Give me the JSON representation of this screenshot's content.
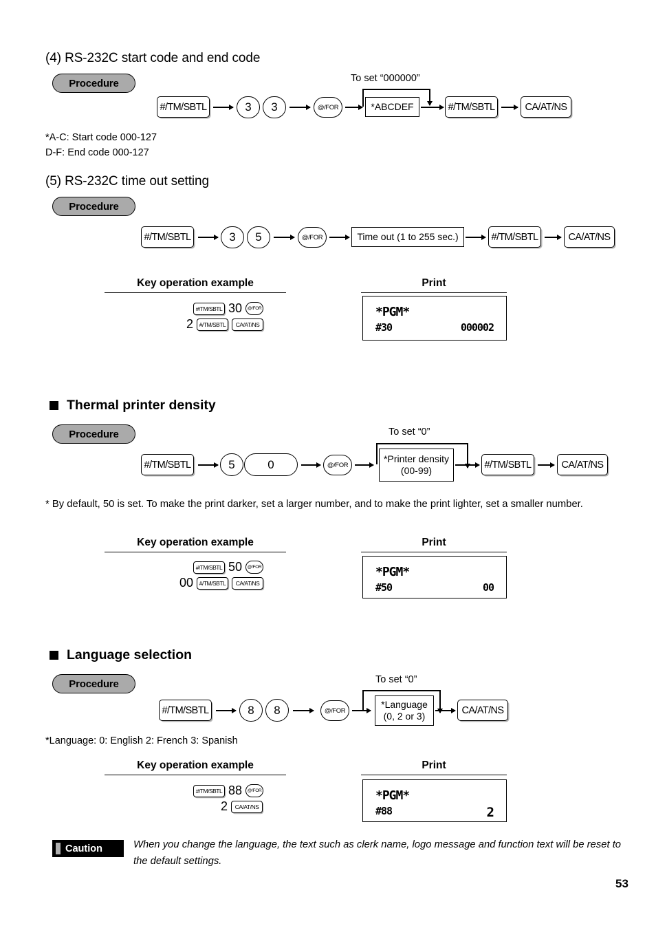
{
  "page": {
    "number": "53"
  },
  "section4": {
    "title": "(4) RS-232C start code and end code",
    "procedure_label": "Procedure",
    "bypass_label": "To set “000000”",
    "flow": [
      {
        "type": "key",
        "label": "#/TM/SBTL"
      },
      {
        "type": "circ",
        "label": "3"
      },
      {
        "type": "circ",
        "label": "3"
      },
      {
        "type": "circ",
        "label": "@/FOR"
      },
      {
        "type": "box",
        "label": "*ABCDEF"
      },
      {
        "type": "key",
        "label": "#/TM/SBTL"
      },
      {
        "type": "key",
        "label": "CA/AT/NS"
      }
    ],
    "notes": [
      "*A-C:  Start code  000-127",
      " D-F:  End code   000-127"
    ]
  },
  "section5": {
    "title": "(5) RS-232C time out setting",
    "procedure_label": "Procedure",
    "flow": [
      {
        "type": "key",
        "label": "#/TM/SBTL"
      },
      {
        "type": "circ",
        "label": "3"
      },
      {
        "type": "circ",
        "label": "5"
      },
      {
        "type": "circ",
        "label": "@/FOR"
      },
      {
        "type": "box",
        "label": "Time out (1 to 255 sec.)"
      },
      {
        "type": "key",
        "label": "#/TM/SBTL"
      },
      {
        "type": "key",
        "label": "CA/AT/NS"
      }
    ],
    "example_header": "Key operation example",
    "print_header": "Print",
    "example": {
      "row1": [
        {
          "type": "skey",
          "label": "#/TM/SBTL"
        },
        {
          "type": "num",
          "label": "30"
        },
        {
          "type": "scirc",
          "label": "@/FOR"
        }
      ],
      "row2": [
        {
          "type": "num",
          "label": "2"
        },
        {
          "type": "skey",
          "label": "#/TM/SBTL"
        },
        {
          "type": "skey",
          "label": "CA/AT/NS"
        }
      ]
    },
    "receipt": {
      "pgm": "*PGM*",
      "code": "#30",
      "value": "000002"
    }
  },
  "thermal": {
    "heading": "Thermal printer density",
    "procedure_label": "Procedure",
    "bypass_label": "To set “0”",
    "flow": [
      {
        "type": "key",
        "label": "#/TM/SBTL"
      },
      {
        "type": "circ",
        "label": "5"
      },
      {
        "type": "oval",
        "label": "0"
      },
      {
        "type": "circ",
        "label": "@/FOR"
      },
      {
        "type": "box",
        "label_line1": "*Printer density",
        "label_line2": "(00-99)"
      },
      {
        "type": "key",
        "label": "#/TM/SBTL"
      },
      {
        "type": "key",
        "label": "CA/AT/NS"
      }
    ],
    "footnote": "* By default, 50 is set.  To make the print darker, set a larger number, and to make the print lighter, set a smaller number.",
    "example_header": "Key operation example",
    "print_header": "Print",
    "example": {
      "row1": [
        {
          "type": "skey",
          "label": "#/TM/SBTL"
        },
        {
          "type": "num",
          "label": "50"
        },
        {
          "type": "scirc",
          "label": "@/FOR"
        }
      ],
      "row2": [
        {
          "type": "num",
          "label": "00"
        },
        {
          "type": "skey",
          "label": "#/TM/SBTL"
        },
        {
          "type": "skey",
          "label": "CA/AT/NS"
        }
      ]
    },
    "receipt": {
      "pgm": "*PGM*",
      "code": "#50",
      "value": "00"
    }
  },
  "language": {
    "heading": "Language selection",
    "procedure_label": "Procedure",
    "bypass_label": "To set “0”",
    "flow": [
      {
        "type": "key",
        "label": "#/TM/SBTL"
      },
      {
        "type": "circ",
        "label": "8"
      },
      {
        "type": "circ",
        "label": "8"
      },
      {
        "type": "circ",
        "label": "@/FOR"
      },
      {
        "type": "box",
        "label_line1": "*Language",
        "label_line2": "(0, 2 or 3)"
      },
      {
        "type": "key",
        "label": "CA/AT/NS"
      }
    ],
    "footnote": "*Language: 0: English        2: French        3: Spanish",
    "example_header": "Key operation example",
    "print_header": "Print",
    "example": {
      "row1": [
        {
          "type": "skey",
          "label": "#/TM/SBTL"
        },
        {
          "type": "num",
          "label": "88"
        },
        {
          "type": "scirc",
          "label": "@/FOR"
        }
      ],
      "row2": [
        {
          "type": "num",
          "label": "2"
        },
        {
          "type": "skey",
          "label": "CA/AT/NS"
        }
      ]
    },
    "receipt": {
      "pgm": "*PGM*",
      "code": "#88",
      "value": "2"
    }
  },
  "caution": {
    "badge": "Caution",
    "text": "When you change the language, the text such as clerk name, logo message and function text will be reset to the default settings."
  }
}
